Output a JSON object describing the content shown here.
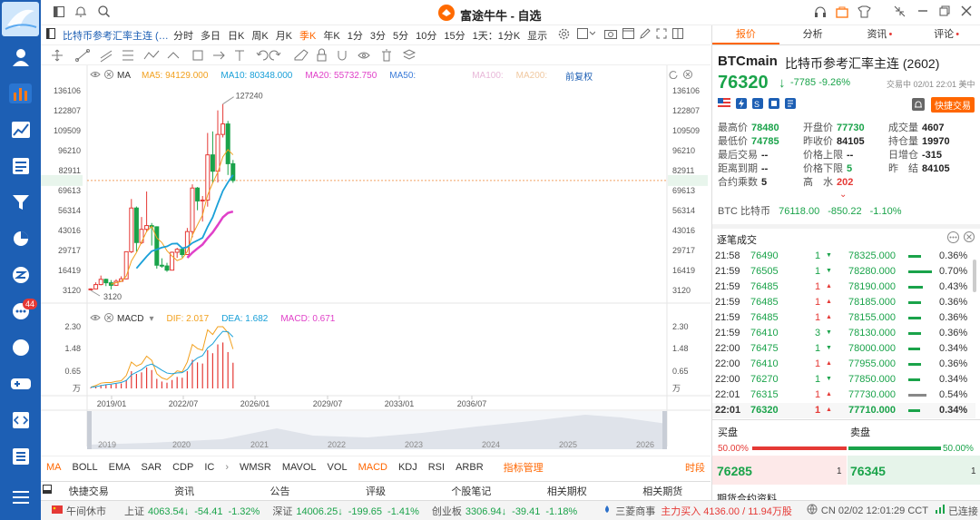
{
  "app": {
    "title": "富途牛牛 - 自选"
  },
  "toolbar": {
    "symbol": "比特币参考汇率主连 (…",
    "periods": [
      "分时",
      "多日",
      "日K",
      "周K",
      "月K",
      "季K",
      "年K",
      "1分",
      "3分",
      "5分",
      "10分",
      "15分",
      "1天：1分K",
      "显示"
    ],
    "active_period": "季K"
  },
  "chart": {
    "ma_label": "MA",
    "ma5": "MA5: 94129.000",
    "ma10": "MA10: 80348.000",
    "ma20": "MA20: 55732.750",
    "ma50": "MA50:",
    "ma100": "MA100:",
    "ma200": "MA200:",
    "adjust": "前复权",
    "left_ticks": [
      "136106",
      "122807",
      "109509",
      "96210",
      "82911",
      "76320",
      "69613",
      "56314",
      "43016",
      "29717",
      "16419",
      "3120"
    ],
    "right_ticks": [
      "136106",
      "122807",
      "109509",
      "96210",
      "82911",
      "76320",
      "69613",
      "56314",
      "43016",
      "29717",
      "16419",
      "3120"
    ],
    "high_label": "127240",
    "low_label": "3120",
    "macd_label": "MACD",
    "dif": "DIF: 2.017",
    "dea": "DEA: 1.682",
    "macd": "MACD: 0.671",
    "macd_ticks_left": [
      "2.30",
      "1.48",
      "0.65",
      "万"
    ],
    "macd_ticks_right": [
      "2.30",
      "1.48",
      "0.65",
      "万"
    ],
    "x_ticks": [
      "2019/01",
      "2022/07",
      "2026/01",
      "2029/07",
      "2033/01",
      "2036/07"
    ],
    "nav_years": [
      "2019",
      "2020",
      "2021",
      "2022",
      "2023",
      "2024",
      "2025",
      "2026"
    ]
  },
  "chart_data": {
    "type": "candlestick",
    "title": "BTCmain 比特币参考汇率主连 (2602)",
    "ylim": [
      3120,
      136106
    ],
    "last_price": 76320,
    "ma": {
      "MA5": 94129.0,
      "MA10": 80348.0,
      "MA20": 55732.75
    },
    "macd": {
      "DIF": 2.017,
      "DEA": 1.682,
      "MACD": 0.671
    },
    "candles": [
      {
        "o": 3800,
        "h": 4500,
        "l": 3120,
        "c": 4100
      },
      {
        "o": 4100,
        "h": 8500,
        "l": 4000,
        "c": 7000
      },
      {
        "o": 7000,
        "h": 13000,
        "l": 6500,
        "c": 10500
      },
      {
        "o": 10500,
        "h": 11000,
        "l": 6000,
        "c": 8200
      },
      {
        "o": 8200,
        "h": 10000,
        "l": 3800,
        "c": 6500
      },
      {
        "o": 6500,
        "h": 10500,
        "l": 6200,
        "c": 9200
      },
      {
        "o": 9200,
        "h": 12500,
        "l": 9000,
        "c": 10800
      },
      {
        "o": 10800,
        "h": 29000,
        "l": 10500,
        "c": 28900
      },
      {
        "o": 28900,
        "h": 64000,
        "l": 28000,
        "c": 58000
      },
      {
        "o": 58000,
        "h": 59000,
        "l": 29000,
        "c": 35000
      },
      {
        "o": 35000,
        "h": 52000,
        "l": 34000,
        "c": 43800
      },
      {
        "o": 43800,
        "h": 69000,
        "l": 42000,
        "c": 46300
      },
      {
        "o": 46300,
        "h": 48000,
        "l": 33000,
        "c": 45500
      },
      {
        "o": 45500,
        "h": 45800,
        "l": 17600,
        "c": 19900
      },
      {
        "o": 19900,
        "h": 24500,
        "l": 18200,
        "c": 19400
      },
      {
        "o": 19400,
        "h": 21500,
        "l": 15500,
        "c": 16600
      },
      {
        "o": 16600,
        "h": 29000,
        "l": 16500,
        "c": 28500
      },
      {
        "o": 28500,
        "h": 31500,
        "l": 24800,
        "c": 30500
      },
      {
        "o": 30500,
        "h": 31800,
        "l": 25000,
        "c": 27000
      },
      {
        "o": 27000,
        "h": 44700,
        "l": 26600,
        "c": 42300
      },
      {
        "o": 42300,
        "h": 73800,
        "l": 38500,
        "c": 71300
      },
      {
        "o": 71300,
        "h": 72000,
        "l": 56500,
        "c": 62700
      },
      {
        "o": 62700,
        "h": 66000,
        "l": 49000,
        "c": 63300
      },
      {
        "o": 63300,
        "h": 108000,
        "l": 58900,
        "c": 93400
      },
      {
        "o": 93400,
        "h": 109000,
        "l": 74500,
        "c": 82500
      },
      {
        "o": 82500,
        "h": 123000,
        "l": 75000,
        "c": 107000
      },
      {
        "o": 107000,
        "h": 127240,
        "l": 105000,
        "c": 114000
      },
      {
        "o": 114000,
        "h": 116000,
        "l": 80000,
        "c": 87500
      },
      {
        "o": 87500,
        "h": 90000,
        "l": 74785,
        "c": 76320
      }
    ],
    "macd_bars": [
      0.02,
      0.05,
      0.09,
      0.1,
      0.1,
      0.12,
      0.13,
      0.22,
      0.45,
      0.38,
      0.42,
      0.55,
      0.48,
      0.25,
      0.18,
      0.15,
      0.22,
      0.3,
      0.28,
      0.45,
      0.75,
      0.68,
      0.65,
      1.0,
      0.92,
      1.15,
      1.2,
      0.95,
      0.671
    ]
  },
  "right": {
    "tabs": [
      "报价",
      "分析",
      "资讯",
      "评论"
    ],
    "code": "BTCmain",
    "name": "比特币参考汇率主连 (2602)",
    "price": "76320",
    "change": "-7785 -9.26%",
    "time": "交易中 02/01 22:01 美中",
    "quick_trade": "快捷交易",
    "stats": [
      [
        "最高价",
        "78480",
        "开盘价",
        "77730",
        "成交量",
        "4607"
      ],
      [
        "最低价",
        "74785",
        "昨收价",
        "84105",
        "持仓量",
        "19970"
      ],
      [
        "最后交易",
        "--",
        "价格上限",
        "--",
        "日增仓",
        "-315"
      ],
      [
        "距离到期",
        "--",
        "价格下限",
        "5",
        "昨　结",
        "84105"
      ],
      [
        "合约乘数",
        "5",
        "高　水",
        "202",
        "",
        ""
      ]
    ],
    "btc_name": "BTC 比特币",
    "btc_price": "76118.00",
    "btc_chg": "-850.22",
    "btc_pct": "-1.10%",
    "trades_title": "逐笔成交",
    "trades": [
      [
        "21:58",
        "76490",
        "1",
        "down",
        "78325.000",
        "0.36%"
      ],
      [
        "21:59",
        "76505",
        "1",
        "down",
        "78280.000",
        "0.70%"
      ],
      [
        "21:59",
        "76485",
        "1",
        "up",
        "78190.000",
        "0.43%"
      ],
      [
        "21:59",
        "76485",
        "1",
        "up",
        "78185.000",
        "0.36%"
      ],
      [
        "21:59",
        "76485",
        "1",
        "up",
        "78155.000",
        "0.36%"
      ],
      [
        "21:59",
        "76410",
        "3",
        "down",
        "78130.000",
        "0.36%"
      ],
      [
        "22:00",
        "76475",
        "1",
        "down",
        "78000.000",
        "0.34%"
      ],
      [
        "22:00",
        "76410",
        "1",
        "up",
        "77955.000",
        "0.36%"
      ],
      [
        "22:00",
        "76270",
        "1",
        "down",
        "77850.000",
        "0.34%"
      ],
      [
        "22:01",
        "76315",
        "1",
        "up",
        "77730.000",
        "0.54%"
      ],
      [
        "22:01",
        "76320",
        "1",
        "up",
        "77710.000",
        "0.34%"
      ]
    ],
    "buy_label": "买盘",
    "sell_label": "卖盘",
    "buy_pct": "50.00%",
    "sell_pct": "50.00%",
    "bid": "76285",
    "bid_qty": "1",
    "ask": "76345",
    "ask_qty": "1",
    "bottom_cut": "期货合约资料"
  },
  "indicators": [
    "MA",
    "BOLL",
    "EMA",
    "SAR",
    "CDP",
    "IC",
    "WMSR",
    "MAVOL",
    "VOL",
    "MACD",
    "KDJ",
    "RSI",
    "ARBR",
    "指标管理",
    "时段"
  ],
  "bottom_tabs": [
    "快捷交易",
    "资讯",
    "公告",
    "评级",
    "个股笔记",
    "相关期权",
    "相关期货"
  ],
  "status": {
    "market_state": "午间休市",
    "idx": [
      [
        "上证",
        "4063.54",
        "-54.41",
        "-1.32%"
      ],
      [
        "深证",
        "14006.25",
        "-199.65",
        "-1.41%"
      ],
      [
        "创业板",
        "3306.94",
        "-39.41",
        "-1.18%"
      ]
    ],
    "news": "三菱商事",
    "flow": "主力买入 4136.00 / 11.94万股",
    "clock": "CN 02/02 12:01:29 CCT",
    "conn": "已连接"
  }
}
